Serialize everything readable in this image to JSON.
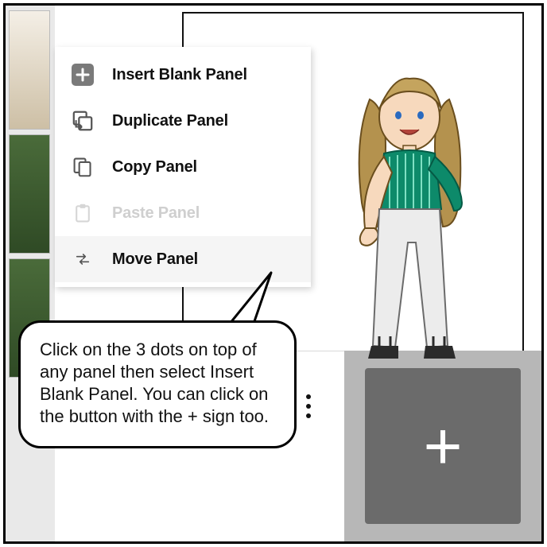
{
  "menu": {
    "insert": "Insert Blank Panel",
    "duplicate": "Duplicate Panel",
    "copy": "Copy Panel",
    "paste": "Paste Panel",
    "move": "Move Panel"
  },
  "bubble": {
    "text": "Click on the 3 dots on top of any panel then select Insert Blank Panel. You can click on the button with the + sign too."
  },
  "plus_button": {
    "symbol": "+"
  }
}
